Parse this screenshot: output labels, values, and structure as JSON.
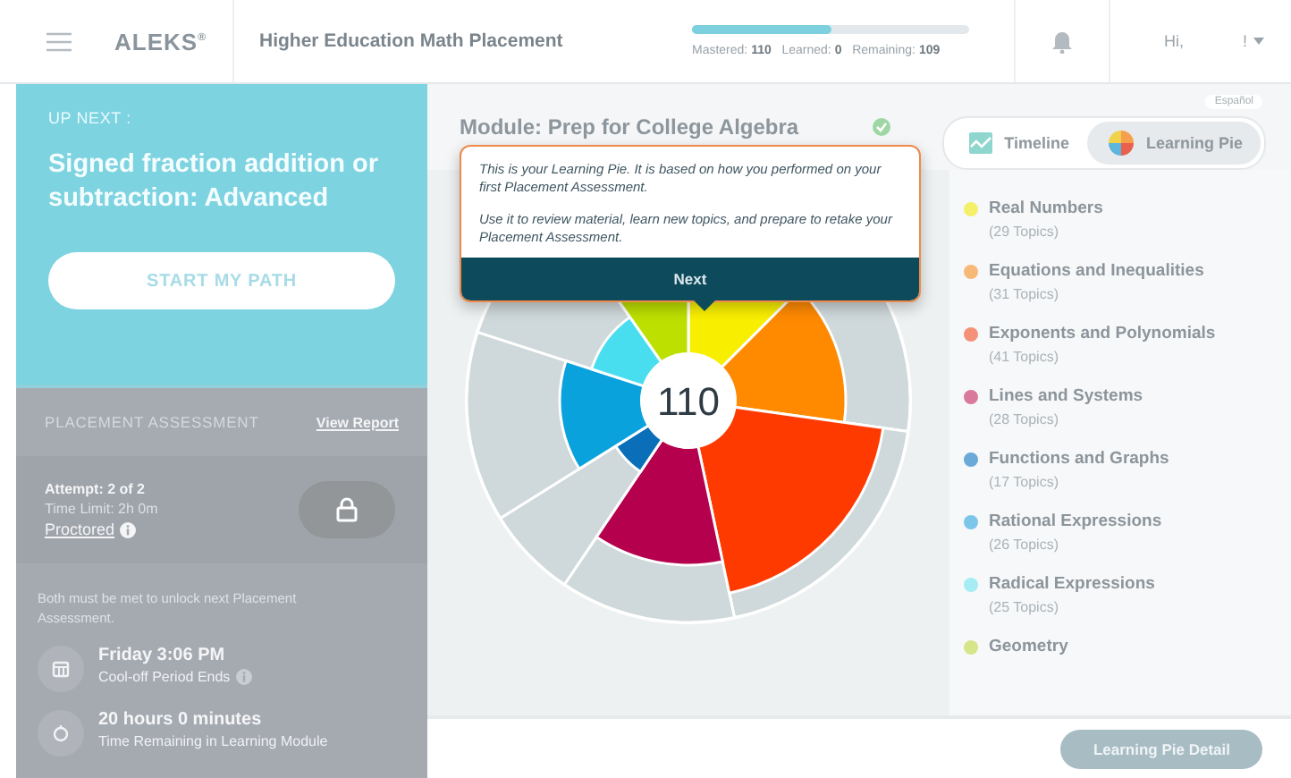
{
  "header": {
    "brand": "ALEKS",
    "brand_mark": "®",
    "title": "Higher Education Math Placement",
    "progress": {
      "level": 0.5,
      "mastered_label": "Mastered:",
      "mastered": "110",
      "learned_label": "Learned:",
      "learned": "0",
      "remaining_label": "Remaining:",
      "remaining": "109"
    },
    "greeting": "Hi,",
    "user": "!"
  },
  "up_next": {
    "label": "UP NEXT :",
    "topic": "Signed fraction addition or subtraction: Advanced",
    "button": "START MY PATH"
  },
  "assessment": {
    "title": "PLACEMENT ASSESSMENT",
    "link": "View Report",
    "attempt": "Attempt: 2 of 2",
    "time_limit": "Time Limit: 2h 0m",
    "proctored": "Proctored",
    "locked": true,
    "note": "Both must be met to unlock next Placement Assessment.",
    "conditions": [
      {
        "kind": "calendar",
        "value": "Friday 3:06 PM",
        "caption": "Cool-off Period Ends",
        "info": true
      },
      {
        "kind": "timer",
        "value": "20 hours 0 minutes",
        "caption": "Time Remaining in Learning Module",
        "info": false
      }
    ]
  },
  "module": {
    "title": "Module: Prep for College Algebra",
    "complete": true
  },
  "language": "Español",
  "view_tabs": [
    {
      "kind": "timeline",
      "label": "Timeline",
      "selected": false
    },
    {
      "kind": "pie",
      "label": "Learning Pie",
      "selected": true
    }
  ],
  "tooltip": {
    "lines": [
      "This is your Learning Pie. It is based on how you performed on your first Placement Assessment.",
      "Use it to review material, learn new topics, and prepare to retake your Placement Assessment."
    ],
    "button": "Next"
  },
  "pie": {
    "center": "110"
  },
  "legend": [
    {
      "name": "Real Numbers",
      "count": "(29 Topics)",
      "color": "#f4f06a"
    },
    {
      "name": "Equations and Inequalities",
      "count": "(31 Topics)",
      "color": "#f7b978"
    },
    {
      "name": "Exponents and Polynomials",
      "count": "(41 Topics)",
      "color": "#f59178"
    },
    {
      "name": "Lines and Systems",
      "count": "(28 Topics)",
      "color": "#d97a9c"
    },
    {
      "name": "Functions and Graphs",
      "count": "(17 Topics)",
      "color": "#6aa9d8"
    },
    {
      "name": "Rational Expressions",
      "count": "(26 Topics)",
      "color": "#7cc6ea"
    },
    {
      "name": "Radical Expressions",
      "count": "(25 Topics)",
      "color": "#a6ecf4"
    },
    {
      "name": "Geometry",
      "color": "#d6e58a"
    }
  ],
  "detail_button": "Learning Pie Detail"
}
